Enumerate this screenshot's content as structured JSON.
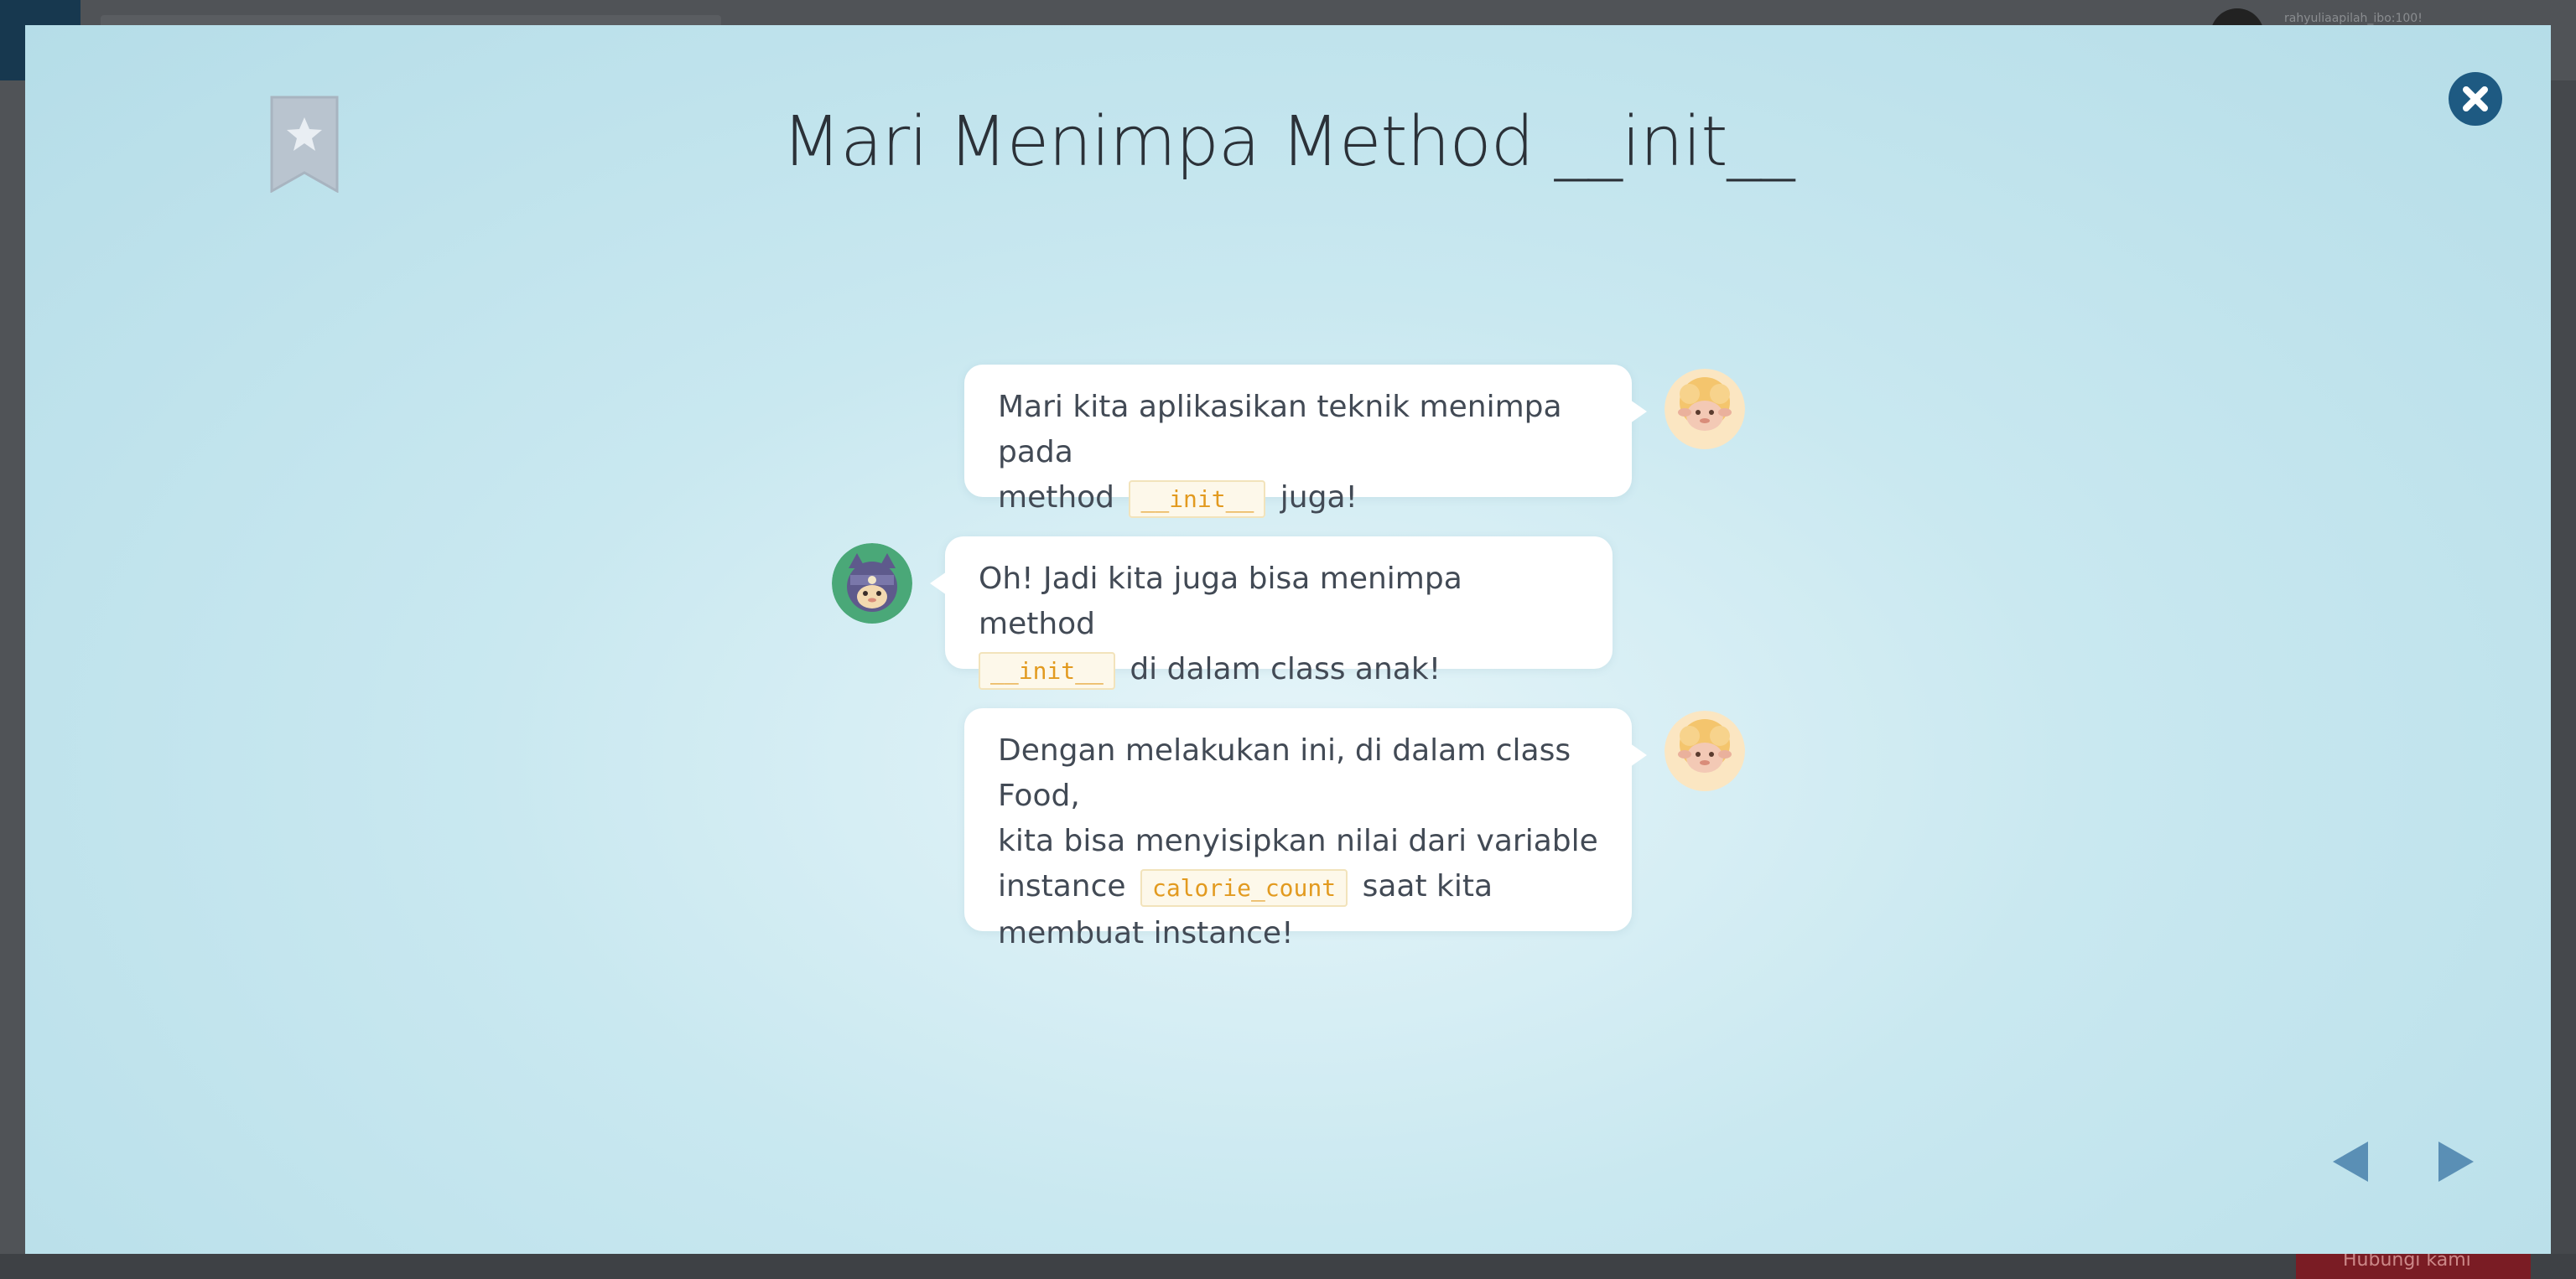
{
  "background": {
    "username": "rahyuliaapilah_ibo:100!",
    "help_label": "Hubungi kami"
  },
  "slide": {
    "title": "Mari Menimpa Method __init__"
  },
  "messages": [
    {
      "speaker": "sheep",
      "side": "right",
      "parts": {
        "a": "Mari kita aplikasikan teknik menimpa pada",
        "b": "method",
        "code": "__init__",
        "c": "juga!"
      }
    },
    {
      "speaker": "ninja-cat",
      "side": "left",
      "parts": {
        "a": "Oh! Jadi kita juga bisa menimpa method",
        "code": "__init__",
        "c": "di dalam class anak!"
      }
    },
    {
      "speaker": "sheep",
      "side": "right",
      "parts": {
        "a": "Dengan melakukan ini, di dalam class Food,",
        "b": "kita bisa menyisipkan nilai dari variable",
        "c": "instance",
        "code": "calorie_count",
        "d": "saat kita",
        "e": "membuat instance!"
      }
    }
  ],
  "icons": {
    "bookmark": "bookmark-star-icon",
    "close": "close-icon",
    "prev": "arrow-left-icon",
    "next": "arrow-right-icon"
  },
  "colors": {
    "accent": "#1e5a82",
    "code_text": "#e29a1f",
    "nav_arrow": "#5a8fb5"
  }
}
